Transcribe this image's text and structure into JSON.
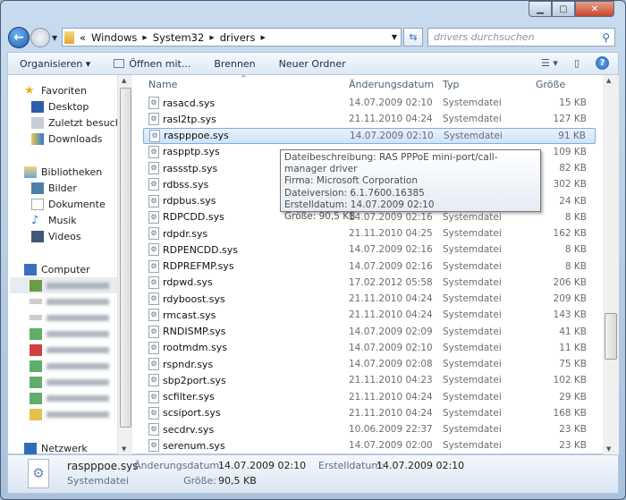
{
  "window": {
    "controls": [
      "minimize",
      "maximize",
      "close"
    ]
  },
  "address": {
    "breadcrumb": [
      "Windows",
      "System32",
      "drivers"
    ],
    "overflow": "«"
  },
  "search": {
    "placeholder": "drivers durchsuchen"
  },
  "toolbar": {
    "organize": "Organisieren ▾",
    "open_with": "Öffnen mit...",
    "burn": "Brennen",
    "new_folder": "Neuer Ordner"
  },
  "sidebar": {
    "favorites": {
      "label": "Favoriten",
      "items": [
        "Desktop",
        "Zuletzt besucht",
        "Downloads"
      ]
    },
    "libraries": {
      "label": "Bibliotheken",
      "items": [
        "Bilder",
        "Dokumente",
        "Musik",
        "Videos"
      ]
    },
    "computer": {
      "label": "Computer"
    },
    "network": {
      "label": "Netzwerk"
    }
  },
  "columns": {
    "name": "Name",
    "date": "Änderungsdatum",
    "type": "Typ",
    "size": "Größe"
  },
  "files": [
    {
      "name": "rasacd.sys",
      "date": "14.07.2009 02:10",
      "type": "Systemdatei",
      "size": "15 KB"
    },
    {
      "name": "rasl2tp.sys",
      "date": "21.11.2010 04:24",
      "type": "Systemdatei",
      "size": "127 KB"
    },
    {
      "name": "raspppoe.sys",
      "date": "14.07.2009 02:10",
      "type": "Systemdatei",
      "size": "91 KB",
      "selected": true
    },
    {
      "name": "raspptp.sys",
      "date": "",
      "type": "",
      "size": "109 KB"
    },
    {
      "name": "rassstp.sys",
      "date": "",
      "type": "",
      "size": "82 KB"
    },
    {
      "name": "rdbss.sys",
      "date": "",
      "type": "",
      "size": "302 KB"
    },
    {
      "name": "rdpbus.sys",
      "date": "",
      "type": "",
      "size": "24 KB"
    },
    {
      "name": "RDPCDD.sys",
      "date": "14.07.2009 02:16",
      "type": "Systemdatei",
      "size": "8 KB"
    },
    {
      "name": "rdpdr.sys",
      "date": "21.11.2010 04:25",
      "type": "Systemdatei",
      "size": "162 KB"
    },
    {
      "name": "RDPENCDD.sys",
      "date": "14.07.2009 02:16",
      "type": "Systemdatei",
      "size": "8 KB"
    },
    {
      "name": "RDPREFMP.sys",
      "date": "14.07.2009 02:16",
      "type": "Systemdatei",
      "size": "8 KB"
    },
    {
      "name": "rdpwd.sys",
      "date": "17.02.2012 05:58",
      "type": "Systemdatei",
      "size": "206 KB"
    },
    {
      "name": "rdyboost.sys",
      "date": "21.11.2010 04:24",
      "type": "Systemdatei",
      "size": "209 KB"
    },
    {
      "name": "rmcast.sys",
      "date": "21.11.2010 04:24",
      "type": "Systemdatei",
      "size": "143 KB"
    },
    {
      "name": "RNDISMP.sys",
      "date": "14.07.2009 02:09",
      "type": "Systemdatei",
      "size": "41 KB"
    },
    {
      "name": "rootmdm.sys",
      "date": "14.07.2009 02:10",
      "type": "Systemdatei",
      "size": "11 KB"
    },
    {
      "name": "rspndr.sys",
      "date": "14.07.2009 02:08",
      "type": "Systemdatei",
      "size": "75 KB"
    },
    {
      "name": "sbp2port.sys",
      "date": "21.11.2010 04:23",
      "type": "Systemdatei",
      "size": "102 KB"
    },
    {
      "name": "scfilter.sys",
      "date": "21.11.2010 04:24",
      "type": "Systemdatei",
      "size": "29 KB"
    },
    {
      "name": "scsiport.sys",
      "date": "21.11.2010 04:24",
      "type": "Systemdatei",
      "size": "168 KB"
    },
    {
      "name": "secdrv.sys",
      "date": "10.06.2009 22:37",
      "type": "Systemdatei",
      "size": "23 KB"
    },
    {
      "name": "serenum.sys",
      "date": "14.07.2009 02:00",
      "type": "Systemdatei",
      "size": "23 KB"
    }
  ],
  "tooltip": {
    "lines": [
      "Dateibeschreibung: RAS PPPoE mini-port/call-manager driver",
      "Firma: Microsoft Corporation",
      "Dateiversion: 6.1.7600.16385",
      "Erstelldatum: 14.07.2009 02:10",
      "Größe: 90,5 KB"
    ]
  },
  "details": {
    "name": "raspppoe.sys",
    "type": "Systemdatei",
    "modified_label": "Änderungsdatum:",
    "modified": "14.07.2009 02:10",
    "created_label": "Erstelldatum:",
    "created": "14.07.2009 02:10",
    "size_label": "Größe:",
    "size": "90,5 KB"
  }
}
